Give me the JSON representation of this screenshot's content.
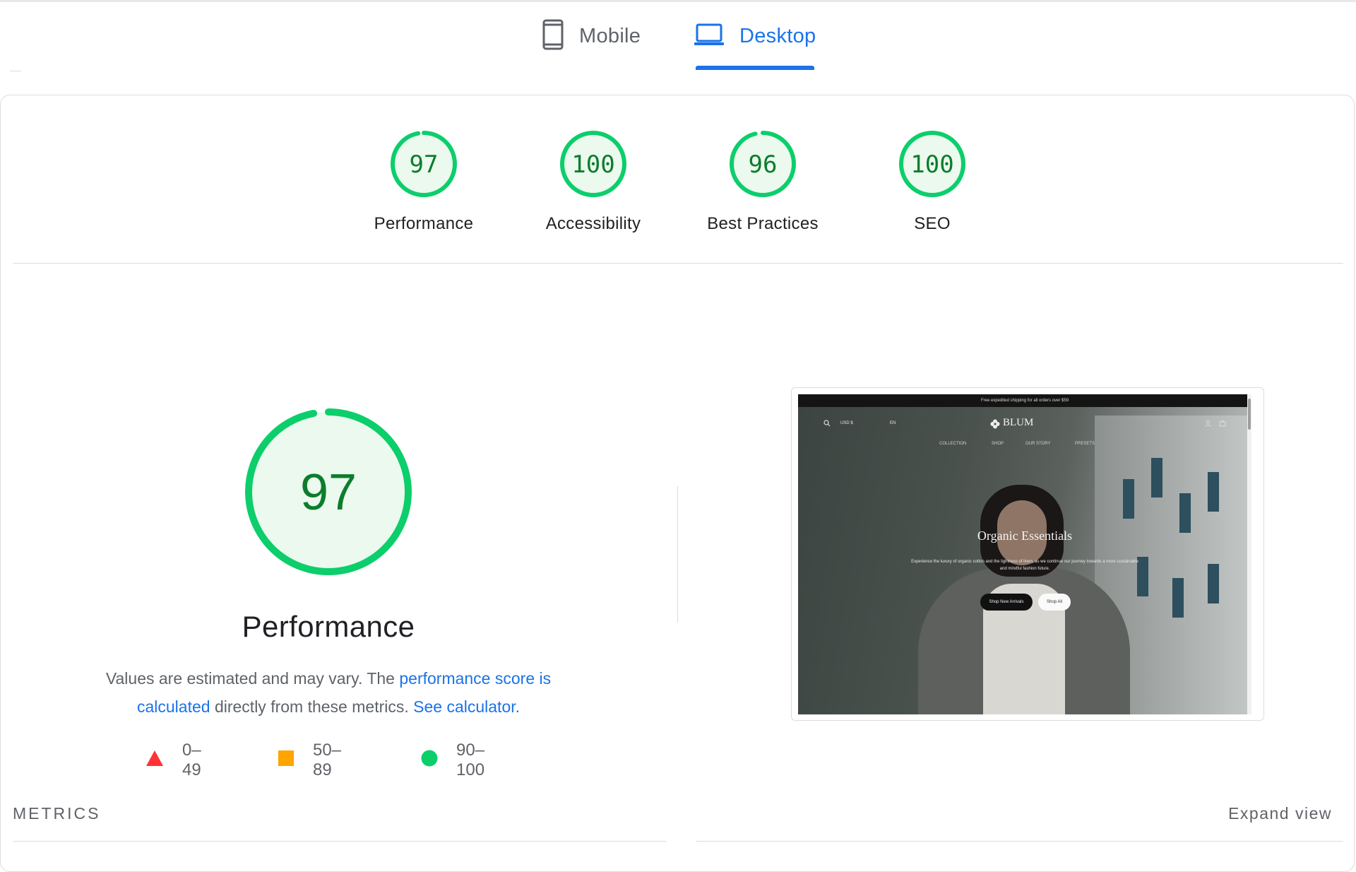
{
  "tabs": [
    {
      "label": "Mobile",
      "icon": "smartphone-icon",
      "active": false
    },
    {
      "label": "Desktop",
      "icon": "laptop-icon",
      "active": true
    }
  ],
  "scores": [
    {
      "label": "Performance",
      "value": "97",
      "fraction": 0.97
    },
    {
      "label": "Accessibility",
      "value": "100",
      "fraction": 1.0
    },
    {
      "label": "Best Practices",
      "value": "96",
      "fraction": 0.96
    },
    {
      "label": "SEO",
      "value": "100",
      "fraction": 1.0
    }
  ],
  "colors": {
    "pass": "#0cce6b",
    "pass_fill": "#ebf9ee",
    "pass_text": "#0c7d2c",
    "average": "#ffa400",
    "fail": "#ff3333",
    "link": "#1a73e8"
  },
  "performance": {
    "score": "97",
    "fraction": 0.97,
    "title": "Performance",
    "desc_prefix": "Values are estimated and may vary. The ",
    "desc_link1": "performance score is calculated",
    "desc_middle": " directly from these metrics. ",
    "desc_link2": "See calculator."
  },
  "legend": [
    {
      "range": "0–49",
      "shape": "triangle-icon"
    },
    {
      "range": "50–89",
      "shape": "square-icon"
    },
    {
      "range": "90–100",
      "shape": "circle-icon"
    }
  ],
  "screenshot": {
    "banner": "Free expedited shipping for all orders over $59",
    "currency": "USD $",
    "language": "EN",
    "brand": "BLUM",
    "menu": [
      "COLLECTION",
      "SHOP",
      "OUR STORY",
      "PRESETS"
    ],
    "hero_title": "Organic Essentials",
    "hero_subtitle": "Experience the luxury of organic cotton and the lightness of linen, as we continue our journey towards a more sustainable and mindful fashion future.",
    "button_primary": "Shop New Arrivals",
    "button_secondary": "Shop All"
  },
  "metrics": {
    "label": "METRICS",
    "expand": "Expand view"
  }
}
